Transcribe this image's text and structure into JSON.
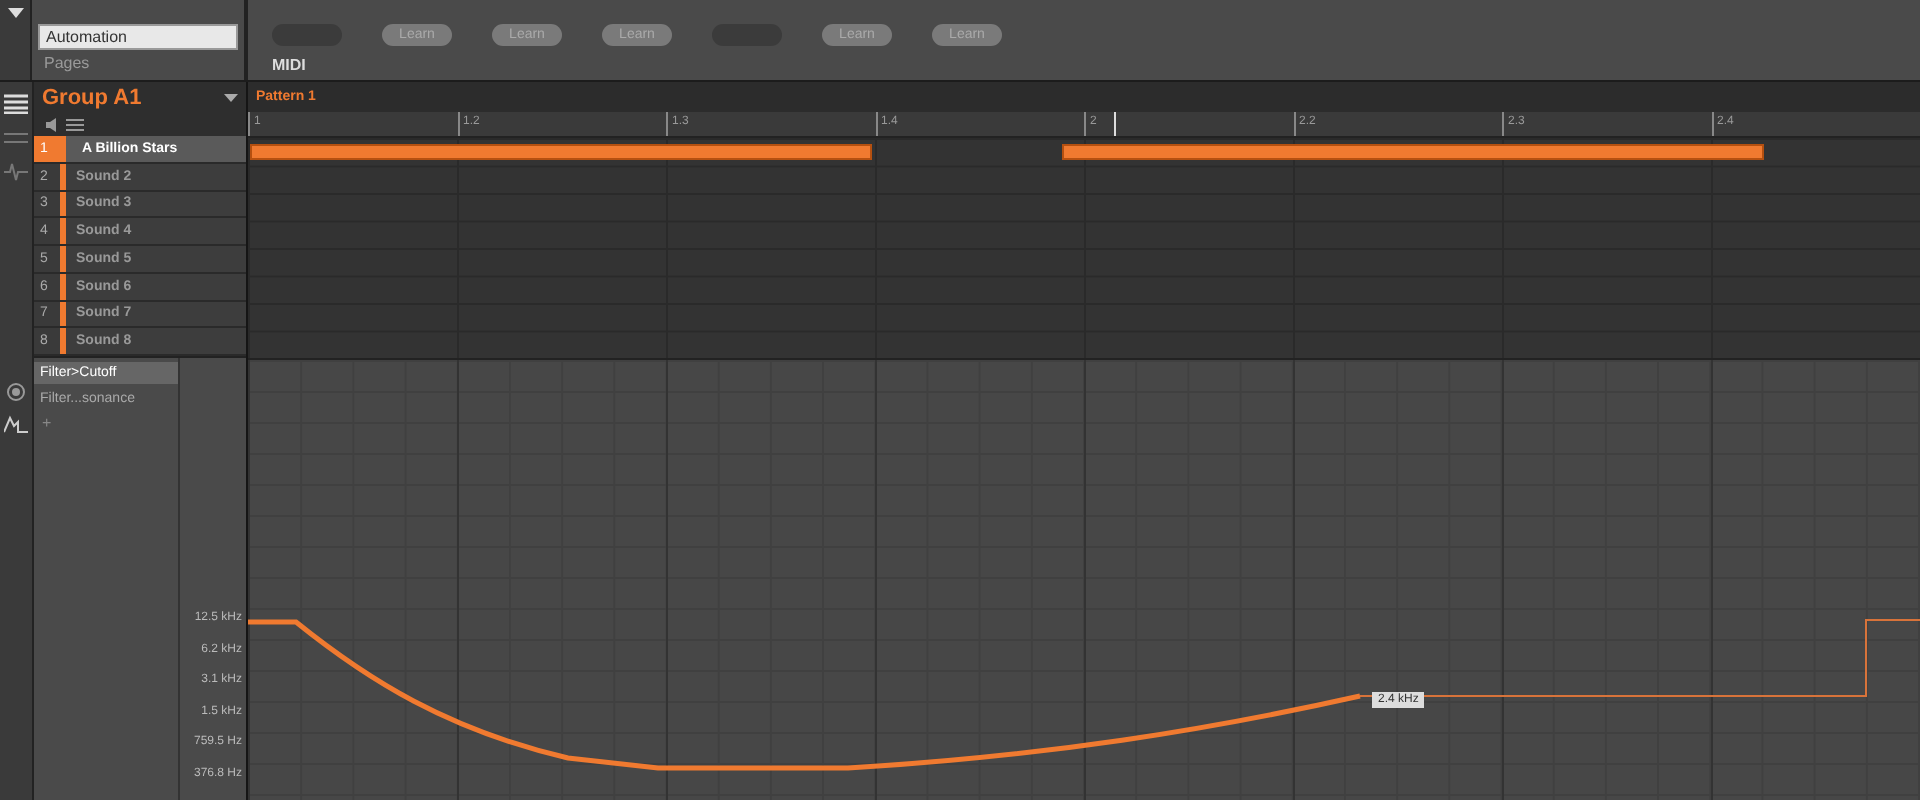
{
  "control_bar": {
    "automation_field": "Automation",
    "pages": "Pages",
    "learn_buttons": [
      {
        "kind": "blank"
      },
      {
        "kind": "learn",
        "label": "Learn"
      },
      {
        "kind": "learn",
        "label": "Learn"
      },
      {
        "kind": "learn",
        "label": "Learn"
      },
      {
        "kind": "blank"
      },
      {
        "kind": "learn",
        "label": "Learn"
      },
      {
        "kind": "learn",
        "label": "Learn"
      }
    ],
    "midi": "MIDI"
  },
  "group": {
    "name": "Group A1"
  },
  "pattern": {
    "name": "Pattern 1",
    "ruler": [
      "1",
      "1.2",
      "1.3",
      "1.4",
      "2",
      "2.2",
      "2.3",
      "2.4"
    ]
  },
  "sounds": [
    {
      "number": "1",
      "name": "A Billion Stars",
      "selected": true
    },
    {
      "number": "2",
      "name": "Sound 2",
      "selected": false
    },
    {
      "number": "3",
      "name": "Sound 3",
      "selected": false
    },
    {
      "number": "4",
      "name": "Sound 4",
      "selected": false
    },
    {
      "number": "5",
      "name": "Sound 5",
      "selected": false
    },
    {
      "number": "6",
      "name": "Sound 6",
      "selected": false
    },
    {
      "number": "7",
      "name": "Sound 7",
      "selected": false
    },
    {
      "number": "8",
      "name": "Sound 8",
      "selected": false
    }
  ],
  "automation": {
    "parameters": [
      {
        "label": "Filter>Cutoff",
        "selected": true
      },
      {
        "label": "Filter...sonance",
        "selected": false
      }
    ],
    "add": "+",
    "axis_labels": [
      "12.5 kHz",
      "6.2 kHz",
      "3.1 kHz",
      "1.5 kHz",
      "759.5 Hz",
      "376.8 Hz"
    ],
    "tooltip": "2.4 kHz"
  }
}
